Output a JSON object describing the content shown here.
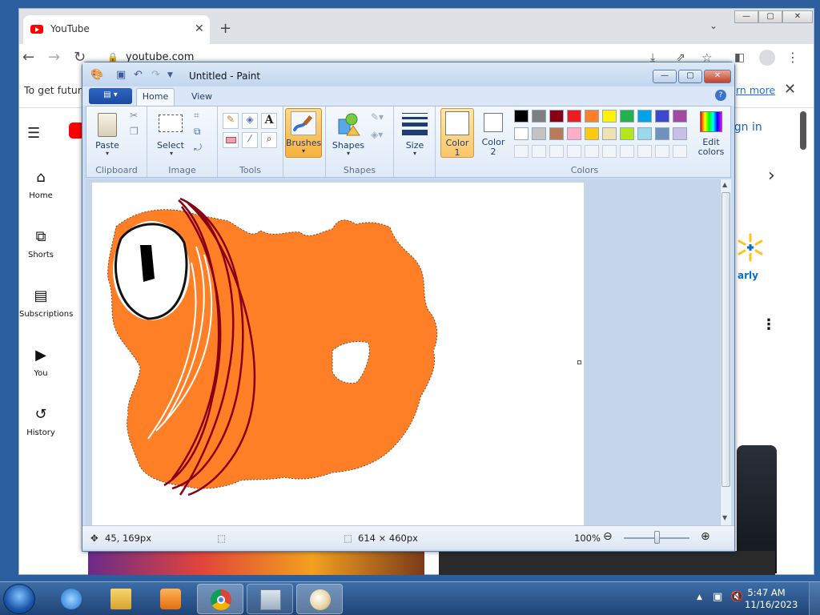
{
  "browser": {
    "tab_title": "YouTube",
    "new_tab": "+",
    "tab_close": "✕",
    "tab_menu": "⌄",
    "url": "youtube.com",
    "win_min": "—",
    "win_max": "▢",
    "win_close": "✕"
  },
  "infobar": {
    "text": "To get future",
    "link": "rn more",
    "close": "✕"
  },
  "youtube": {
    "sidebar": [
      {
        "label": "Home",
        "icon": "home-icon"
      },
      {
        "label": "Shorts",
        "icon": "shorts-icon"
      },
      {
        "label": "Subscriptions",
        "icon": "subscriptions-icon"
      },
      {
        "label": "You",
        "icon": "you-icon"
      },
      {
        "label": "History",
        "icon": "history-icon"
      }
    ],
    "sign_in": "Sign in",
    "promo_text": "arly",
    "more": "⋮",
    "next": "›"
  },
  "paint": {
    "title": "Untitled - Paint",
    "tabs": {
      "home": "Home",
      "view": "View"
    },
    "groups": {
      "clipboard": "Clipboard",
      "image": "Image",
      "tools": "Tools",
      "shapes": "Shapes",
      "colors": "Colors"
    },
    "buttons": {
      "paste": "Paste",
      "select": "Select",
      "brushes": "Brushes",
      "shapes": "Shapes",
      "size": "Size",
      "color1_a": "Color",
      "color1_b": "1",
      "color2_a": "Color",
      "color2_b": "2",
      "edit_colors_a": "Edit",
      "edit_colors_b": "colors"
    },
    "palette": [
      "#000000",
      "#7f7f7f",
      "#880015",
      "#ed1c24",
      "#ff7f27",
      "#fff200",
      "#22b14c",
      "#00a2e8",
      "#3f48cc",
      "#a349a4",
      "#ffffff",
      "#c3c3c3",
      "#b97a57",
      "#ffaec9",
      "#ffc90e",
      "#efe4b0",
      "#b5e61d",
      "#99d9ea",
      "#7092be",
      "#c8bfe7"
    ],
    "color1": "#ffffff",
    "color2": "#ffffff",
    "drawing_fill": "#ff7f27",
    "stroke_dark_red": "#880015",
    "status": {
      "position": "45, 169px",
      "canvas_size": "614 × 460px",
      "zoom": "100%"
    }
  },
  "taskbar": {
    "time": "5:47 AM",
    "date": "11/16/2023"
  }
}
